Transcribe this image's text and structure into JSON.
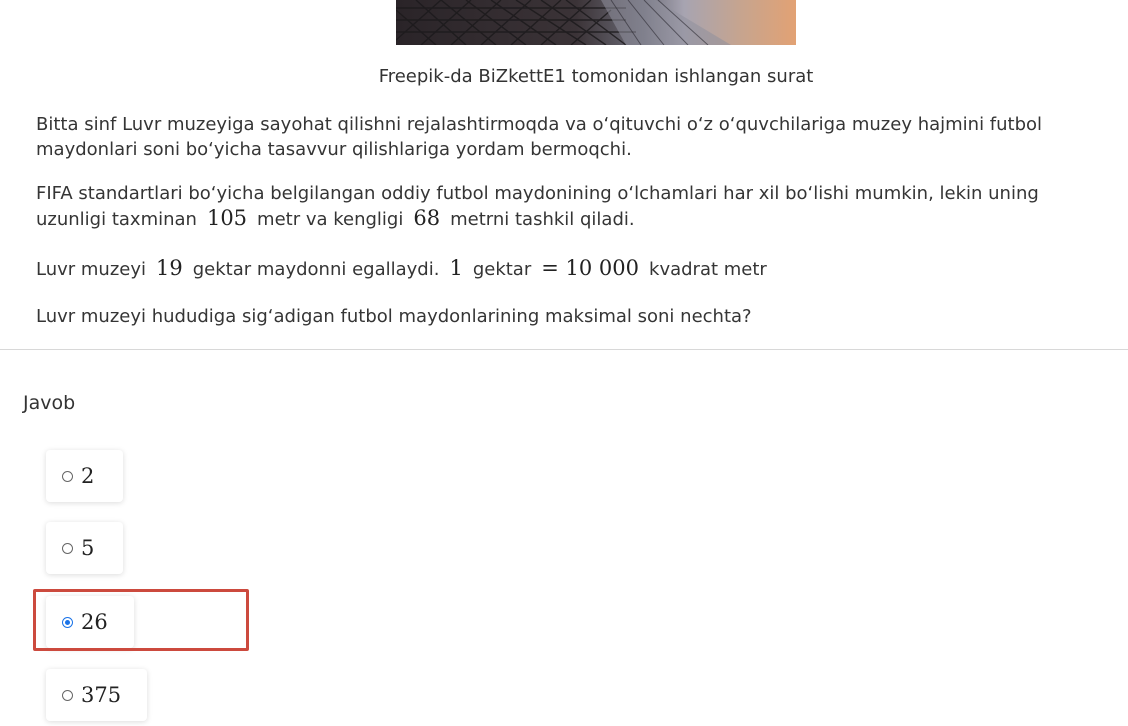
{
  "image": {
    "semantic": "louvre-pyramid-photo"
  },
  "caption": "Freepik-da BiZkettE1 tomonidan ishlangan surat",
  "paragraphs": {
    "p1": "Bitta sinf Luvr muzeyiga sayohat qilishni rejalashtirmoqda va o‘qituvchi o‘z o‘quvchilariga muzey hajmini futbol maydonlari soni bo‘yicha tasavvur qilishlariga yordam bermoqchi.",
    "p2": {
      "a": "FIFA standartlari bo‘yicha belgilangan oddiy futbol maydonining o‘lchamlari har xil bo‘lishi mumkin, lekin uning uzunligi taxminan",
      "v1": "105",
      "b": "metr va kengligi",
      "v2": "68",
      "c": "metrni tashkil qiladi."
    },
    "p3": {
      "a": "Luvr muzeyi",
      "v1": "19",
      "b": "gektar maydonni egallaydi.",
      "v2": "1",
      "c": "gektar",
      "v3": "= 10 000",
      "d": "kvadrat metr"
    },
    "question": "Luvr muzeyi hududiga sig‘adigan futbol maydonlarining maksimal soni nechta?"
  },
  "answer": {
    "label": "Javob",
    "options": [
      {
        "label": "2",
        "selected": false
      },
      {
        "label": "5",
        "selected": false
      },
      {
        "label": "26",
        "selected": true
      },
      {
        "label": "375",
        "selected": false
      }
    ],
    "highlight_color": "#cc4a3e",
    "radio_color": "#1a73e8"
  }
}
